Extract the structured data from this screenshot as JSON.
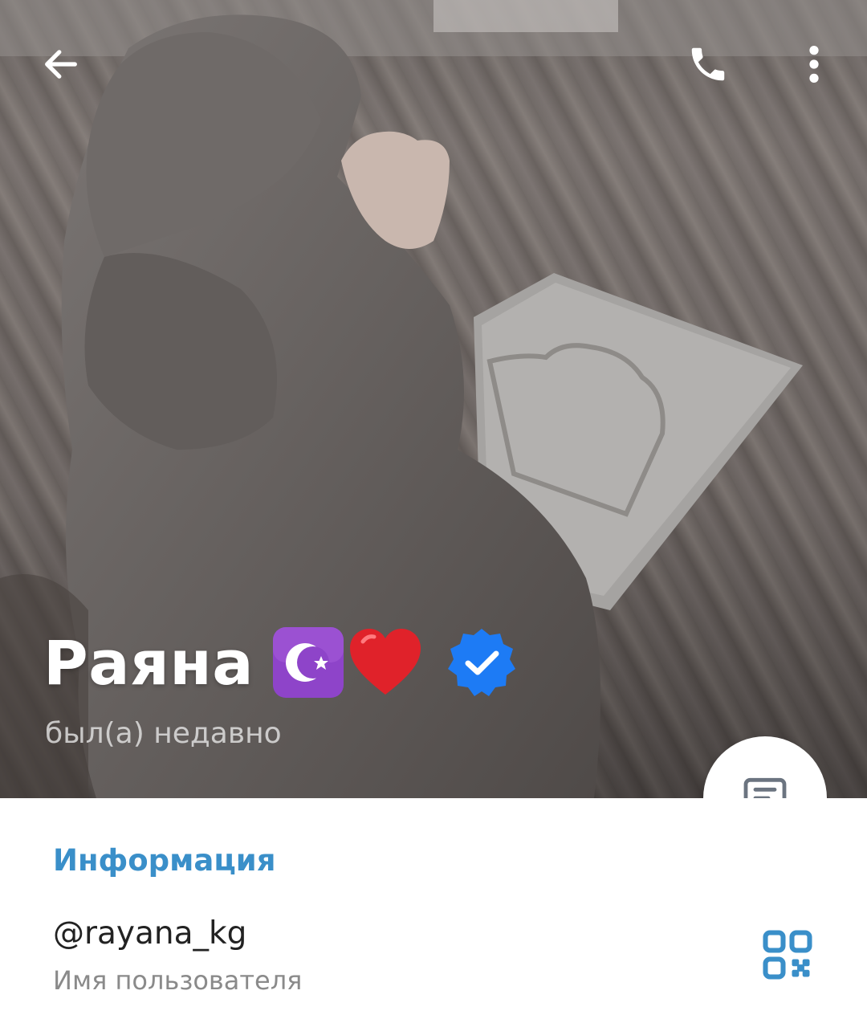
{
  "header": {
    "back_icon": "arrow-left-icon",
    "call_icon": "phone-icon",
    "more_icon": "more-vertical-icon"
  },
  "profile": {
    "name": "Раяна",
    "name_emoji": [
      "star-and-crescent-emoji",
      "red-heart-emoji"
    ],
    "verified_icon": "verified-badge-icon",
    "status": "был(а) недавно"
  },
  "fab": {
    "icon": "message-icon"
  },
  "info": {
    "section_title": "Информация",
    "username": "@rayana_kg",
    "username_caption": "Имя пользователя",
    "qr_icon": "qr-code-icon"
  },
  "colors": {
    "accent": "#3a8fc9",
    "verified": "#1d7bf5",
    "emoji_purple": "#8e44c9",
    "heart": "#e0222a",
    "text_primary": "#222222",
    "text_secondary": "#8a8a8a"
  }
}
